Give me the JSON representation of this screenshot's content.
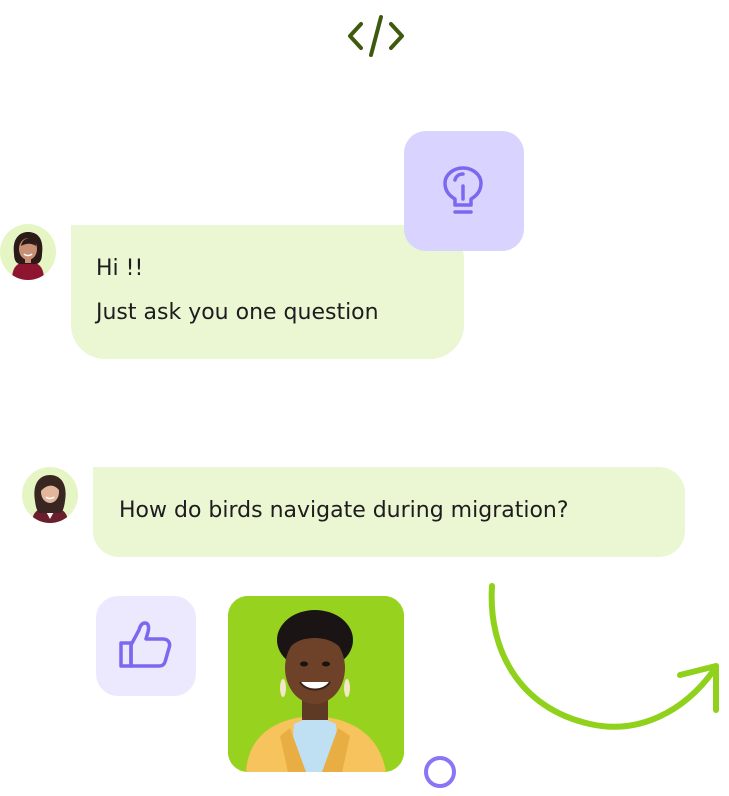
{
  "chat": {
    "message_1": {
      "line_1": "Hi !!",
      "line_2": "Just ask you one question"
    },
    "message_2": {
      "text": "How do birds navigate during migration?"
    }
  },
  "icons": {
    "top": "code-icon",
    "tile_top": "lightbulb-icon",
    "tile_bottom": "thumbs-up-icon",
    "decoration_arrow": "curved-arrow",
    "decoration_ring": "circle-ring"
  },
  "colors": {
    "accent_purple": "#7b68ee",
    "accent_green": "#8fd11b",
    "bubble_bg": "#ebf6d2",
    "code_icon": "#3f5a0f",
    "bulb_tile_bg": "#d9d3ff",
    "thumb_tile_bg": "#ece9ff"
  }
}
